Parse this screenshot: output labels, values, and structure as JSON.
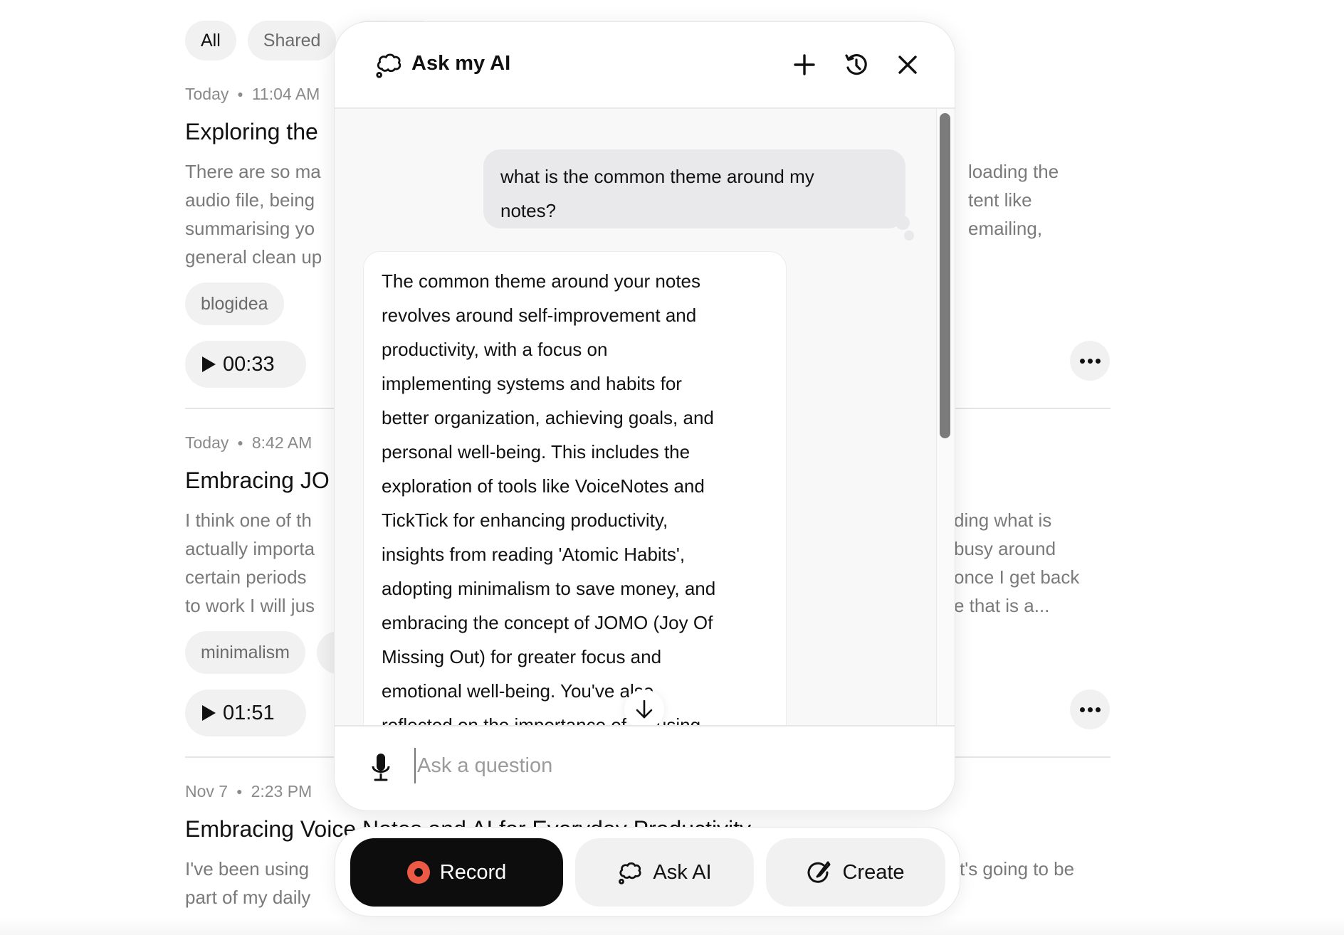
{
  "filters": [
    {
      "label": "All",
      "active": true
    },
    {
      "label": "Shared",
      "active": false
    }
  ],
  "notes": [
    {
      "date": "Today",
      "time": "11:04 AM",
      "title": "Exploring the",
      "body_left": [
        "There are so ma",
        "audio file, being",
        "summarising yo",
        "general clean up"
      ],
      "body_right": [
        "loading the",
        "tent like",
        "emailing,",
        ""
      ],
      "tags": [
        "blogidea"
      ],
      "duration": "00:33"
    },
    {
      "date": "Today",
      "time": "8:42 AM",
      "title": "Embracing JO",
      "body_left": [
        "I think one of th",
        "actually importa",
        "certain periods",
        "to work I will jus"
      ],
      "body_right": [
        "ding what is",
        " busy around",
        "once I get back",
        "e that is a..."
      ],
      "tags": [
        "minimalism",
        ""
      ],
      "duration": "01:51"
    },
    {
      "date": "Nov 7",
      "time": "2:23 PM",
      "title": "Embracing Voice Notes and AI for Everyday Productivity",
      "body_left": [
        "I've been using",
        "part of my daily"
      ],
      "body_right": [
        "t's going to be",
        ""
      ]
    }
  ],
  "panel": {
    "title": "Ask my AI",
    "icons": {
      "title": "thought-cloud-icon",
      "new_chat": "plus-icon",
      "history": "history-icon",
      "close": "close-icon"
    },
    "messages": [
      {
        "role": "user",
        "lines": [
          "what is the common theme around my",
          "notes?"
        ]
      },
      {
        "role": "assistant",
        "lines": [
          "The common theme around your notes",
          "revolves around self-improvement and",
          "productivity, with a focus on",
          "implementing systems and habits for",
          "better organization, achieving goals, and",
          "personal well-being. This includes the",
          "exploration of tools like VoiceNotes and",
          "TickTick for enhancing productivity,",
          "insights from reading 'Atomic Habits',",
          "adopting minimalism to save money, and",
          "embracing the concept of JOMO (Joy Of",
          "Missing Out) for greater focus and",
          "emotional well-being. You've also",
          "reflected on the importance of focusing"
        ]
      }
    ],
    "input": {
      "placeholder": "Ask a question",
      "value": ""
    }
  },
  "actions": {
    "record": "Record",
    "ask_ai": "Ask AI",
    "create": "Create"
  },
  "colors": {
    "record_accent": "#ec5a45",
    "record_bg": "#0d0d0d",
    "pill_bg": "#f1f1f1",
    "user_bubble": "#e9e9eb"
  }
}
